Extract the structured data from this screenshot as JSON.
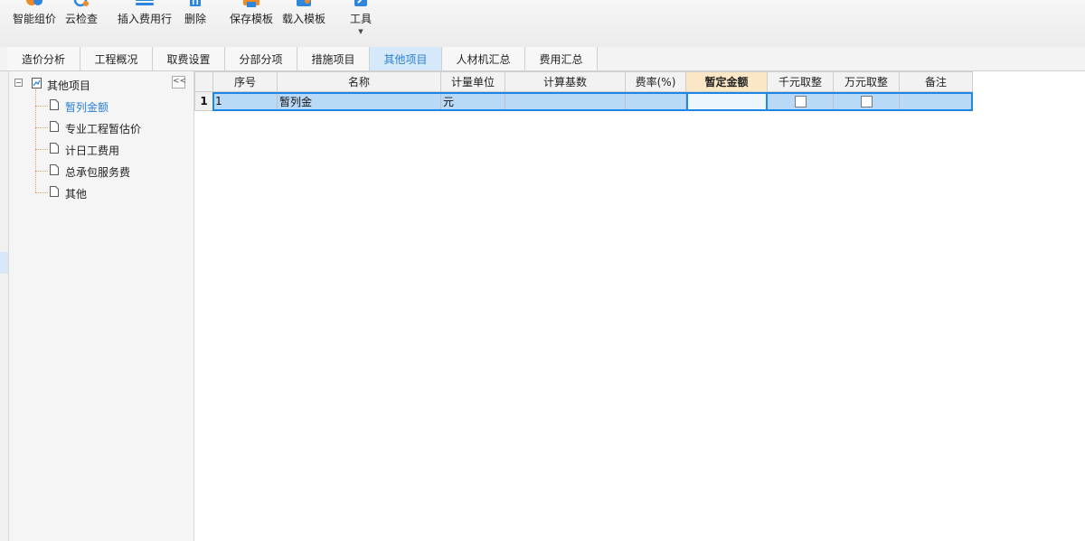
{
  "toolbar": {
    "items": [
      {
        "label": "智能组价"
      },
      {
        "label": "云检查"
      },
      {
        "label": "插入费用行"
      },
      {
        "label": "删除"
      },
      {
        "label": "保存模板"
      },
      {
        "label": "载入模板"
      },
      {
        "label": "工具"
      }
    ]
  },
  "tabs": [
    {
      "label": "造价分析"
    },
    {
      "label": "工程概况"
    },
    {
      "label": "取费设置"
    },
    {
      "label": "分部分项"
    },
    {
      "label": "措施项目"
    },
    {
      "label": "其他项目"
    },
    {
      "label": "人材机汇总"
    },
    {
      "label": "费用汇总"
    }
  ],
  "tree": {
    "root": "其他项目",
    "collapse_symbol": "<<",
    "toggle_symbol": "−",
    "items": [
      {
        "label": "暂列金额"
      },
      {
        "label": "专业工程暂估价"
      },
      {
        "label": "计日工费用"
      },
      {
        "label": "总承包服务费"
      },
      {
        "label": "其他"
      }
    ]
  },
  "grid": {
    "columns": [
      "序号",
      "名称",
      "计量单位",
      "计算基数",
      "费率(%)",
      "暂定金额",
      "千元取整",
      "万元取整",
      "备注"
    ],
    "rows": [
      {
        "row_no": "1",
        "seq": "1",
        "name": "暂列金",
        "unit": "元",
        "base": "",
        "rate": "",
        "amount": "",
        "remark": ""
      }
    ]
  }
}
